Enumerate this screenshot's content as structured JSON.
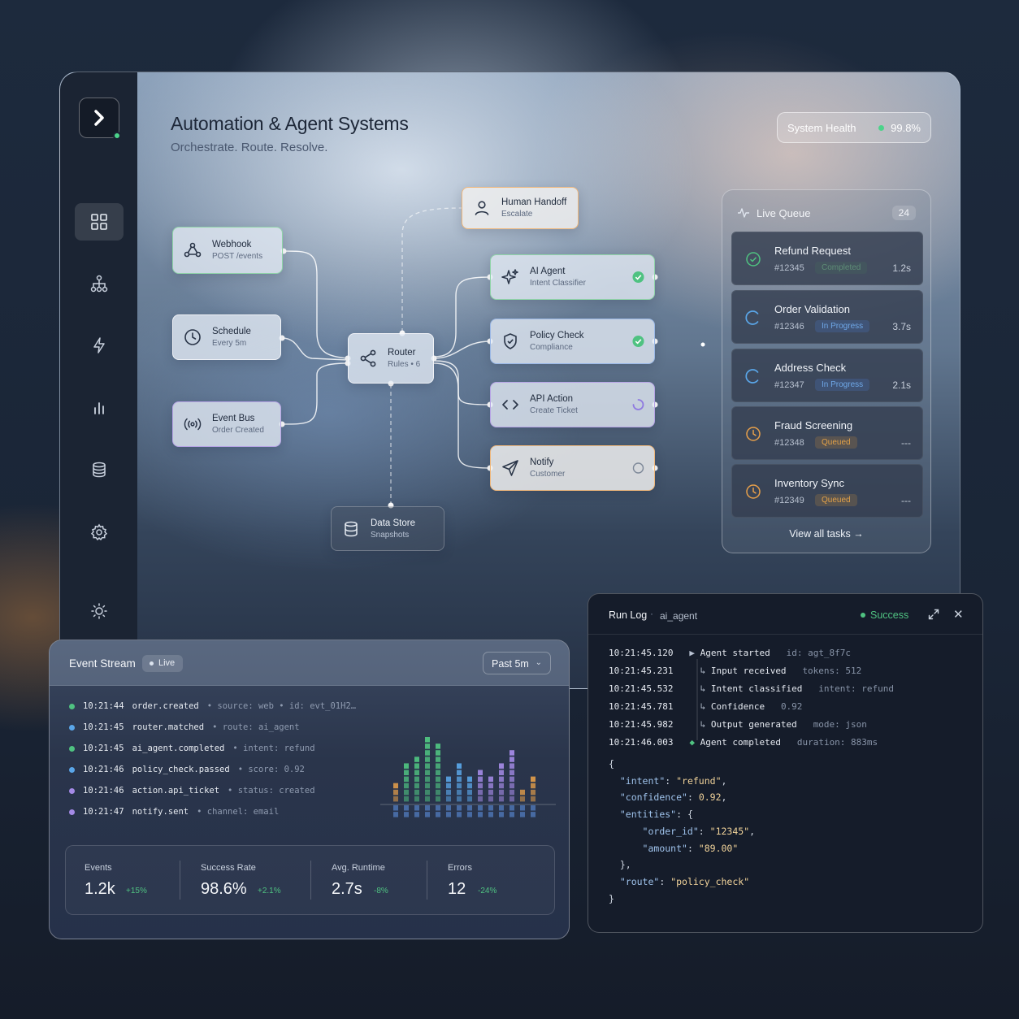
{
  "header": {
    "title": "Automation & Agent Systems",
    "subtitle": "Orchestrate. Route. Resolve.",
    "health_label": "System Health",
    "health_value": "99.8%"
  },
  "sidebar": {
    "items": [
      {
        "icon": "grid-icon",
        "active": true
      },
      {
        "icon": "hierarchy-icon"
      },
      {
        "icon": "lightning-icon"
      },
      {
        "icon": "bar-chart-icon"
      },
      {
        "icon": "database-icon"
      },
      {
        "icon": "gear-icon"
      },
      {
        "icon": "sun-icon"
      }
    ]
  },
  "flow": {
    "webhook": {
      "title": "Webhook",
      "sub": "POST /events"
    },
    "schedule": {
      "title": "Schedule",
      "sub": "Every 5m"
    },
    "event_bus": {
      "title": "Event Bus",
      "sub": "Order Created"
    },
    "router": {
      "title": "Router",
      "sub": "Rules • 6"
    },
    "human_handoff": {
      "title": "Human Handoff",
      "sub": "Escalate"
    },
    "ai_agent": {
      "title": "AI Agent",
      "sub": "Intent Classifier"
    },
    "policy_check": {
      "title": "Policy Check",
      "sub": "Compliance"
    },
    "api_action": {
      "title": "API Action",
      "sub": "Create Ticket"
    },
    "notify": {
      "title": "Notify",
      "sub": "Customer"
    },
    "data_store": {
      "title": "Data Store",
      "sub": "Snapshots"
    }
  },
  "queue": {
    "title": "Live Queue",
    "count": "24",
    "tasks": [
      {
        "name": "Refund Request",
        "id": "#12345",
        "status": "Completed",
        "duration": "1.2s"
      },
      {
        "name": "Order Validation",
        "id": "#12346",
        "status": "In Progress",
        "duration": "3.7s"
      },
      {
        "name": "Address Check",
        "id": "#12347",
        "status": "In Progress",
        "duration": "2.1s"
      },
      {
        "name": "Fraud Screening",
        "id": "#12348",
        "status": "Queued",
        "duration": "---"
      },
      {
        "name": "Inventory Sync",
        "id": "#12349",
        "status": "Queued",
        "duration": "---"
      }
    ],
    "view_all": "View all tasks"
  },
  "event_stream": {
    "title": "Event Stream",
    "live": "Live",
    "range": "Past 5m",
    "events": [
      {
        "time": "10:21:44",
        "name": "order.created",
        "meta": "• source: web  • id: evt_01H2…",
        "color": "#4fc281"
      },
      {
        "time": "10:21:45",
        "name": "router.matched",
        "meta": "• route: ai_agent",
        "color": "#5aa6e8"
      },
      {
        "time": "10:21:45",
        "name": "ai_agent.completed",
        "meta": "• intent: refund",
        "color": "#4fc281"
      },
      {
        "time": "10:21:46",
        "name": "policy_check.passed",
        "meta": "• score: 0.92",
        "color": "#5aa6e8"
      },
      {
        "time": "10:21:46",
        "name": "action.api_ticket",
        "meta": "• status: created",
        "color": "#a48ae6"
      },
      {
        "time": "10:21:47",
        "name": "notify.sent",
        "meta": "• channel: email",
        "color": "#a48ae6"
      }
    ],
    "metrics": [
      {
        "label": "Events",
        "value": "1.2k",
        "delta": "+15%"
      },
      {
        "label": "Success Rate",
        "value": "98.6%",
        "delta": "+2.1%"
      },
      {
        "label": "Avg. Runtime",
        "value": "2.7s",
        "delta": "-8%"
      },
      {
        "label": "Errors",
        "value": "12",
        "delta": "-24%"
      }
    ],
    "histogram": {
      "levels": [
        3,
        6,
        7,
        10,
        9,
        4,
        6,
        4,
        5,
        4,
        6,
        8,
        2,
        4
      ],
      "colors": [
        "#e8a04a",
        "#4fc281",
        "#4fc281",
        "#4fc281",
        "#4fc281",
        "#5aa6e8",
        "#5aa6e8",
        "#5aa6e8",
        "#a48ae6",
        "#a48ae6",
        "#a48ae6",
        "#a48ae6",
        "#e8a04a",
        "#e8a04a"
      ]
    }
  },
  "run_log": {
    "title": "Run Log",
    "agent": "ai_agent",
    "status": "Success",
    "close": "✕",
    "lines": [
      {
        "time": "10:21:45.120",
        "marker": "▶",
        "msg": "Agent started",
        "meta": "id: agt_8f7c"
      },
      {
        "time": "10:21:45.231",
        "marker": "↳",
        "msg": "Input received",
        "meta": "tokens: 512"
      },
      {
        "time": "10:21:45.532",
        "marker": "↳",
        "msg": "Intent classified",
        "meta": "intent: refund"
      },
      {
        "time": "10:21:45.781",
        "marker": "↳",
        "msg": "Confidence",
        "meta": "0.92"
      },
      {
        "time": "10:21:45.982",
        "marker": "↳",
        "msg": "Output generated",
        "meta": "mode: json"
      },
      {
        "time": "10:21:46.003",
        "marker": "◆",
        "msg": "Agent completed",
        "meta": "duration: 883ms"
      }
    ],
    "json": [
      {
        "indent": "",
        "text": "{"
      },
      {
        "indent": "  ",
        "key": "\"intent\"",
        "val": "\"refund\"",
        "tail": ","
      },
      {
        "indent": "  ",
        "key": "\"confidence\"",
        "val": "0.92",
        "tail": ","
      },
      {
        "indent": "  ",
        "key": "\"entities\"",
        "text": ": {"
      },
      {
        "indent": "      ",
        "key": "\"order_id\"",
        "val": "\"12345\"",
        "tail": ","
      },
      {
        "indent": "      ",
        "key": "\"amount\"",
        "val": "\"89.00\"",
        "tail": ""
      },
      {
        "indent": "  ",
        "text": "},"
      },
      {
        "indent": "  ",
        "key": "\"route\"",
        "val": "\"policy_check\"",
        "tail": ""
      },
      {
        "indent": "",
        "text": "}"
      }
    ]
  },
  "colors": {
    "success": "#4fc281",
    "progress": "#5aa6e8",
    "queued": "#e8a04a",
    "accent_purple": "#a48ae6"
  }
}
